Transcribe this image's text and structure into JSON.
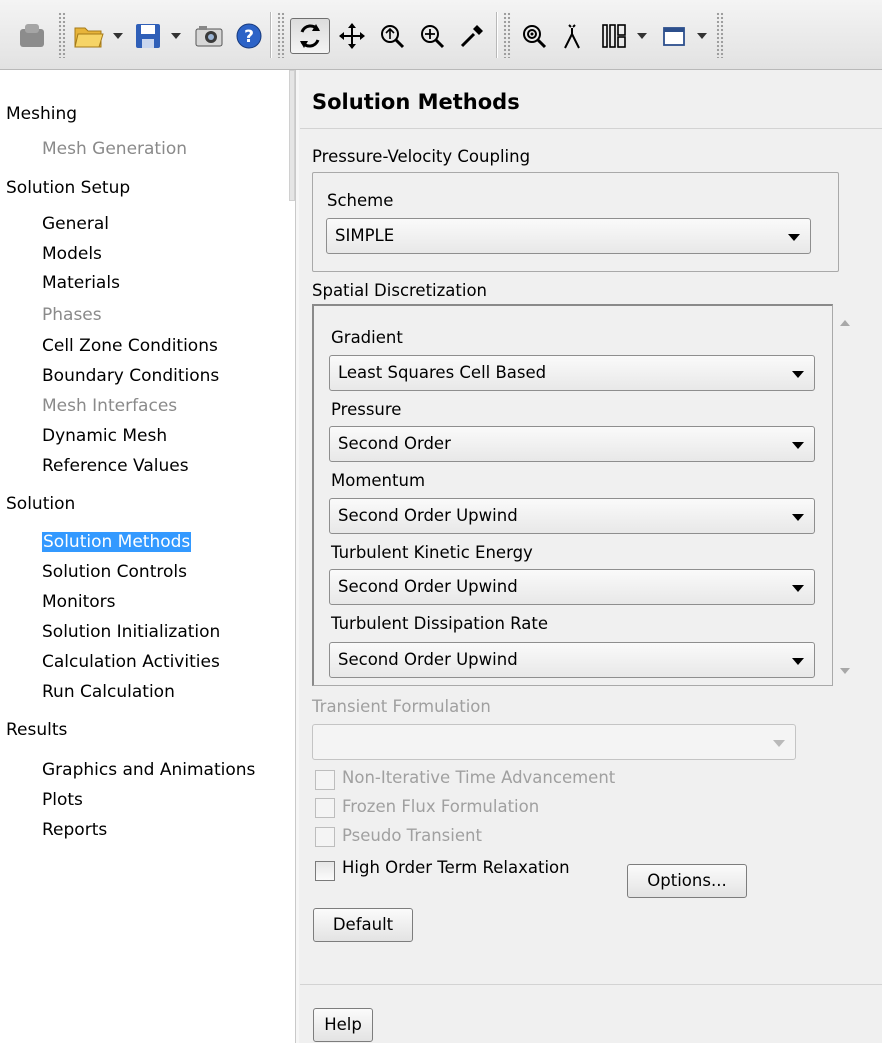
{
  "toolbar": {
    "icons": [
      "display-icon",
      "open-folder-icon",
      "save-icon",
      "camera-icon",
      "help-icon",
      "rotate-icon",
      "pan-icon",
      "zoom-icon",
      "zoom-in-icon",
      "probe-icon",
      "zoom-to-fit-icon",
      "mouse-probe-icon",
      "layout-icon",
      "window-icon"
    ]
  },
  "nav": {
    "meshing": "Meshing",
    "mesh_generation": "Mesh Generation",
    "solution_setup": "Solution Setup",
    "general": "General",
    "models": "Models",
    "materials": "Materials",
    "phases": "Phases",
    "cell_zone_conditions": "Cell Zone Conditions",
    "boundary_conditions": "Boundary Conditions",
    "mesh_interfaces": "Mesh Interfaces",
    "dynamic_mesh": "Dynamic Mesh",
    "reference_values": "Reference Values",
    "solution": "Solution",
    "solution_methods": "Solution Methods",
    "solution_controls": "Solution Controls",
    "monitors": "Monitors",
    "solution_initialization": "Solution Initialization",
    "calculation_activities": "Calculation Activities",
    "run_calculation": "Run Calculation",
    "results": "Results",
    "graphics_and_animations": "Graphics and Animations",
    "plots": "Plots",
    "reports": "Reports"
  },
  "panel": {
    "title": "Solution Methods",
    "pvc_label": "Pressure-Velocity Coupling",
    "scheme_label": "Scheme",
    "scheme_value": "SIMPLE",
    "spatial_label": "Spatial Discretization",
    "gradient_label": "Gradient",
    "gradient_value": "Least Squares Cell Based",
    "pressure_label": "Pressure",
    "pressure_value": "Second Order",
    "momentum_label": "Momentum",
    "momentum_value": "Second Order Upwind",
    "tke_label": "Turbulent Kinetic Energy",
    "tke_value": "Second Order Upwind",
    "tdr_label": "Turbulent Dissipation Rate",
    "tdr_value": "Second Order Upwind",
    "transient_label": "Transient Formulation",
    "transient_value": "",
    "non_iterative": "Non-Iterative Time Advancement",
    "frozen_flux": "Frozen Flux Formulation",
    "pseudo_transient": "Pseudo Transient",
    "high_order": "High Order Term Relaxation",
    "options_button": "Options...",
    "default_button": "Default",
    "help_button": "Help"
  },
  "colors": {
    "selection": "#3399ff",
    "panel_bg": "#f0f0f0",
    "disabled_text": "#8a8a8a"
  }
}
